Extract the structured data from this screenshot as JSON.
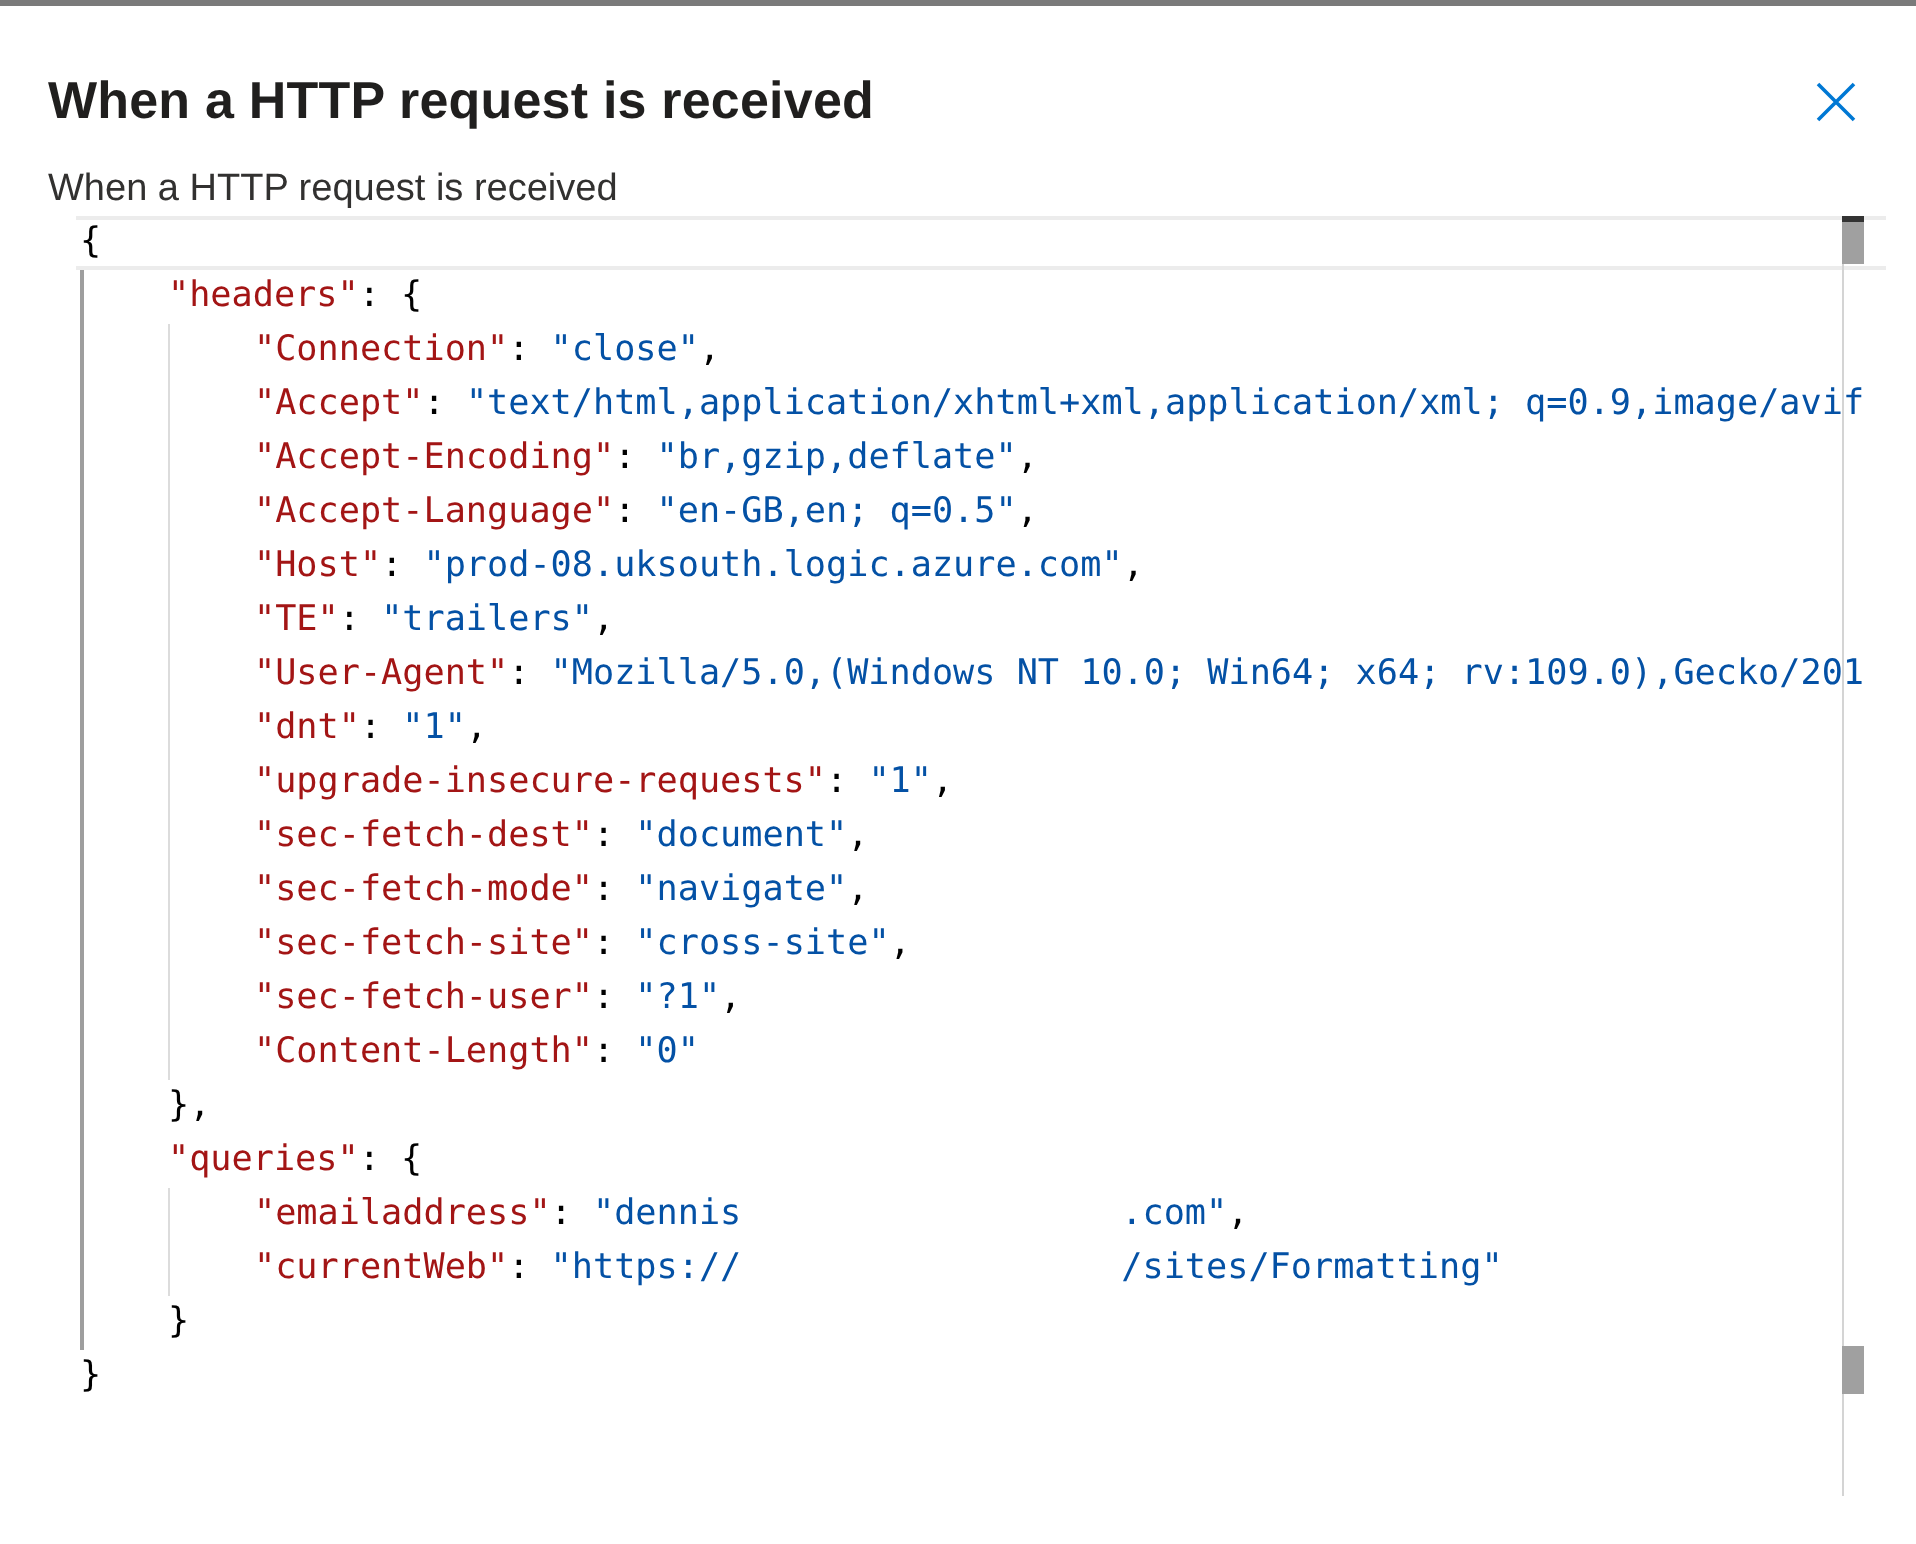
{
  "panel": {
    "title": "When a HTTP request is received",
    "subtitle": "When a HTTP request is received"
  },
  "code": [
    {
      "tokens": [
        {
          "kind": "punct",
          "text": "{"
        }
      ],
      "children": [
        {
          "tokens": [
            {
              "kind": "key",
              "text": "\"headers\""
            },
            {
              "kind": "punct",
              "text": ": {"
            }
          ],
          "children": [
            {
              "tokens": [
                {
                  "kind": "key",
                  "text": "\"Connection\""
                },
                {
                  "kind": "punct",
                  "text": ": "
                },
                {
                  "kind": "string",
                  "text": "\"close\""
                },
                {
                  "kind": "punct",
                  "text": ","
                }
              ]
            },
            {
              "tokens": [
                {
                  "kind": "key",
                  "text": "\"Accept\""
                },
                {
                  "kind": "punct",
                  "text": ": "
                },
                {
                  "kind": "string",
                  "text": "\"text/html,application/xhtml+xml,application/xml; q=0.9,image/avif"
                }
              ]
            },
            {
              "tokens": [
                {
                  "kind": "key",
                  "text": "\"Accept-Encoding\""
                },
                {
                  "kind": "punct",
                  "text": ": "
                },
                {
                  "kind": "string",
                  "text": "\"br,gzip,deflate\""
                },
                {
                  "kind": "punct",
                  "text": ","
                }
              ]
            },
            {
              "tokens": [
                {
                  "kind": "key",
                  "text": "\"Accept-Language\""
                },
                {
                  "kind": "punct",
                  "text": ": "
                },
                {
                  "kind": "string",
                  "text": "\"en-GB,en; q=0.5\""
                },
                {
                  "kind": "punct",
                  "text": ","
                }
              ]
            },
            {
              "tokens": [
                {
                  "kind": "key",
                  "text": "\"Host\""
                },
                {
                  "kind": "punct",
                  "text": ": "
                },
                {
                  "kind": "string",
                  "text": "\"prod-08.uksouth.logic.azure.com\""
                },
                {
                  "kind": "punct",
                  "text": ","
                }
              ]
            },
            {
              "tokens": [
                {
                  "kind": "key",
                  "text": "\"TE\""
                },
                {
                  "kind": "punct",
                  "text": ": "
                },
                {
                  "kind": "string",
                  "text": "\"trailers\""
                },
                {
                  "kind": "punct",
                  "text": ","
                }
              ]
            },
            {
              "tokens": [
                {
                  "kind": "key",
                  "text": "\"User-Agent\""
                },
                {
                  "kind": "punct",
                  "text": ": "
                },
                {
                  "kind": "string",
                  "text": "\"Mozilla/5.0,(Windows NT 10.0; Win64; x64; rv:109.0),Gecko/201"
                }
              ]
            },
            {
              "tokens": [
                {
                  "kind": "key",
                  "text": "\"dnt\""
                },
                {
                  "kind": "punct",
                  "text": ": "
                },
                {
                  "kind": "string",
                  "text": "\"1\""
                },
                {
                  "kind": "punct",
                  "text": ","
                }
              ]
            },
            {
              "tokens": [
                {
                  "kind": "key",
                  "text": "\"upgrade-insecure-requests\""
                },
                {
                  "kind": "punct",
                  "text": ": "
                },
                {
                  "kind": "string",
                  "text": "\"1\""
                },
                {
                  "kind": "punct",
                  "text": ","
                }
              ]
            },
            {
              "tokens": [
                {
                  "kind": "key",
                  "text": "\"sec-fetch-dest\""
                },
                {
                  "kind": "punct",
                  "text": ": "
                },
                {
                  "kind": "string",
                  "text": "\"document\""
                },
                {
                  "kind": "punct",
                  "text": ","
                }
              ]
            },
            {
              "tokens": [
                {
                  "kind": "key",
                  "text": "\"sec-fetch-mode\""
                },
                {
                  "kind": "punct",
                  "text": ": "
                },
                {
                  "kind": "string",
                  "text": "\"navigate\""
                },
                {
                  "kind": "punct",
                  "text": ","
                }
              ]
            },
            {
              "tokens": [
                {
                  "kind": "key",
                  "text": "\"sec-fetch-site\""
                },
                {
                  "kind": "punct",
                  "text": ": "
                },
                {
                  "kind": "string",
                  "text": "\"cross-site\""
                },
                {
                  "kind": "punct",
                  "text": ","
                }
              ]
            },
            {
              "tokens": [
                {
                  "kind": "key",
                  "text": "\"sec-fetch-user\""
                },
                {
                  "kind": "punct",
                  "text": ": "
                },
                {
                  "kind": "string",
                  "text": "\"?1\""
                },
                {
                  "kind": "punct",
                  "text": ","
                }
              ]
            },
            {
              "tokens": [
                {
                  "kind": "key",
                  "text": "\"Content-Length\""
                },
                {
                  "kind": "punct",
                  "text": ": "
                },
                {
                  "kind": "string",
                  "text": "\"0\""
                }
              ]
            }
          ]
        },
        {
          "tokens": [
            {
              "kind": "punct",
              "text": "},"
            }
          ]
        },
        {
          "tokens": [
            {
              "kind": "key",
              "text": "\"queries\""
            },
            {
              "kind": "punct",
              "text": ": {"
            }
          ],
          "children": [
            {
              "tokens": [
                {
                  "kind": "key",
                  "text": "\"emailaddress\""
                },
                {
                  "kind": "punct",
                  "text": ": "
                },
                {
                  "kind": "string",
                  "text": "\"dennis"
                },
                {
                  "kind": "redacted"
                },
                {
                  "kind": "string",
                  "text": ".com\""
                },
                {
                  "kind": "punct",
                  "text": ","
                }
              ]
            },
            {
              "tokens": [
                {
                  "kind": "key",
                  "text": "\"currentWeb\""
                },
                {
                  "kind": "punct",
                  "text": ": "
                },
                {
                  "kind": "string",
                  "text": "\"https://"
                },
                {
                  "kind": "redacted"
                },
                {
                  "kind": "string",
                  "text": "/sites/Formatting\""
                }
              ]
            }
          ]
        },
        {
          "tokens": [
            {
              "kind": "punct",
              "text": "}"
            }
          ]
        }
      ]
    },
    {
      "tokens": [
        {
          "kind": "punct",
          "text": "}"
        }
      ]
    }
  ]
}
